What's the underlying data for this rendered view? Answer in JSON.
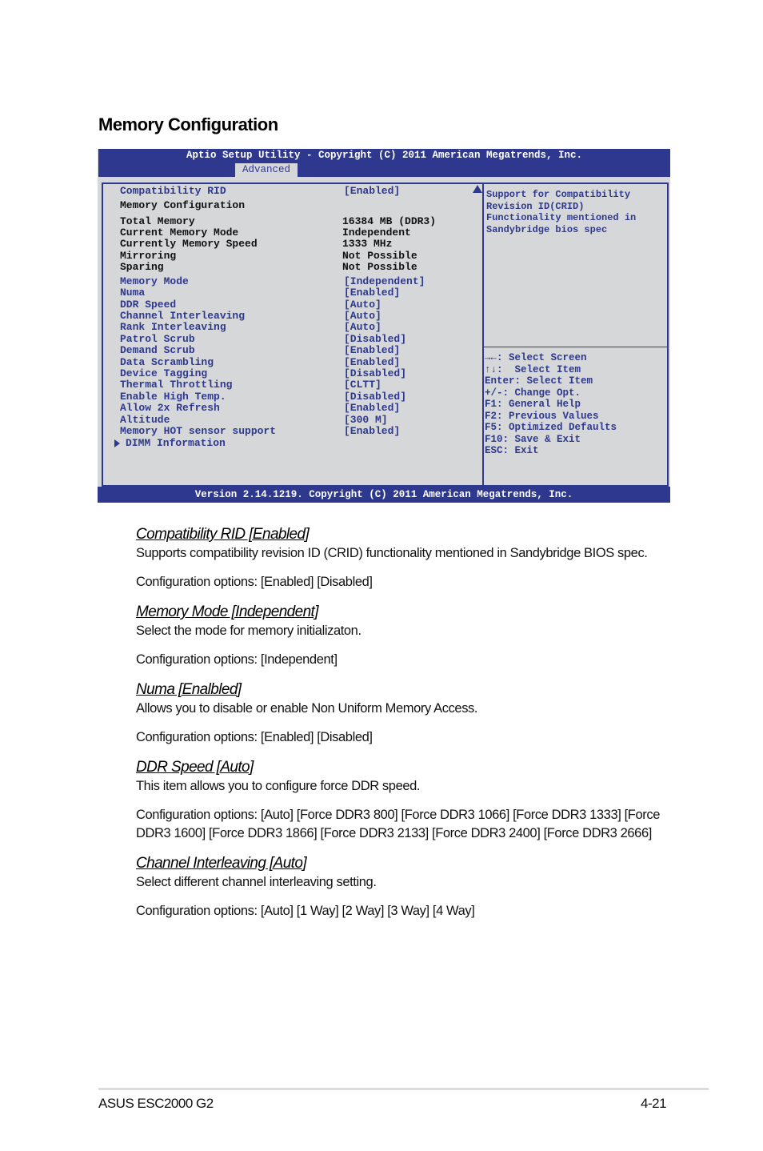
{
  "page": {
    "title": "Memory Configuration",
    "footer_left": "ASUS ESC2000 G2",
    "footer_right": "4-21"
  },
  "bios": {
    "header_title": "Aptio Setup Utility - Copyright (C) 2011 American Megatrends, Inc.",
    "active_tab": "Advanced",
    "footer": "Version 2.14.1219. Copyright (C) 2011 American Megatrends, Inc.",
    "colors": {
      "frame": "#2e388f",
      "background": "#d6d7d9",
      "text_static": "#111111"
    },
    "items": [
      {
        "label": "Compatibility RID",
        "value": "[Enabled]",
        "type": "option"
      },
      {
        "label": "Memory Configuration",
        "value": "",
        "type": "heading"
      },
      {
        "label": "Total Memory",
        "value": "16384 MB (DDR3)",
        "type": "info"
      },
      {
        "label": "Current Memory Mode",
        "value": "Independent",
        "type": "info"
      },
      {
        "label": "Currently Memory Speed",
        "value": "1333 MHz",
        "type": "info"
      },
      {
        "label": "Mirroring",
        "value": "Not Possible",
        "type": "info"
      },
      {
        "label": "Sparing",
        "value": "Not Possible",
        "type": "info"
      },
      {
        "label": "Memory Mode",
        "value": "[Independent]",
        "type": "option"
      },
      {
        "label": "Numa",
        "value": "[Enabled]",
        "type": "option"
      },
      {
        "label": "DDR Speed",
        "value": "[Auto]",
        "type": "option"
      },
      {
        "label": "Channel Interleaving",
        "value": "[Auto]",
        "type": "option"
      },
      {
        "label": "Rank Interleaving",
        "value": "[Auto]",
        "type": "option"
      },
      {
        "label": "Patrol Scrub",
        "value": "[Disabled]",
        "type": "option"
      },
      {
        "label": "Demand Scrub",
        "value": "[Enabled]",
        "type": "option"
      },
      {
        "label": "Data Scrambling",
        "value": "[Enabled]",
        "type": "option"
      },
      {
        "label": "Device Tagging",
        "value": "[Disabled]",
        "type": "option"
      },
      {
        "label": "Thermal Throttling",
        "value": "[CLTT]",
        "type": "option"
      },
      {
        "label": "Enable High Temp.",
        "value": "[Disabled]",
        "type": "option"
      },
      {
        "label": "Allow 2x Refresh",
        "value": "[Enabled]",
        "type": "option"
      },
      {
        "label": "Altitude",
        "value": "[300 M]",
        "type": "option"
      },
      {
        "label": "Memory HOT sensor support",
        "value": "[Enabled]",
        "type": "option"
      },
      {
        "label": "DIMM Information",
        "value": "",
        "type": "submenu"
      }
    ],
    "help_text": "Support for Compatibility\nRevision ID(CRID)\nFunctionality mentioned in\nSandybridge bios spec",
    "keys": [
      "→←: Select Screen",
      "↑↓:  Select Item",
      "Enter: Select Item",
      "+/-: Change Opt.",
      "F1: General Help",
      "F2: Previous Values",
      "F5: Optimized Defaults",
      "F10: Save & Exit",
      "ESC: Exit"
    ]
  },
  "sections": [
    {
      "title": "Compatibility RID [Enabled]",
      "description": "Supports compatibility revision ID (CRID) functionality mentioned in Sandybridge BIOS spec.",
      "options": "Configuration options: [Enabled] [Disabled]"
    },
    {
      "title": "Memory Mode [Independent]",
      "description": "Select the mode for memory initializaton.",
      "options": "Configuration options: [Independent]"
    },
    {
      "title": "Numa [Enalbled]",
      "description": "Allows you to disable or enable Non Uniform Memory Access.",
      "options": "Configuration options: [Enabled] [Disabled]"
    },
    {
      "title": "DDR Speed [Auto]",
      "description": "This item allows you to configure force DDR speed.",
      "options": "Configuration options: [Auto] [Force DDR3 800] [Force DDR3 1066] [Force DDR3 1333] [Force DDR3 1600] [Force DDR3 1866] [Force DDR3 2133] [Force DDR3 2400] [Force DDR3 2666]"
    },
    {
      "title": "Channel Interleaving [Auto]",
      "description": "Select different channel interleaving setting.",
      "options": "Configuration options: [Auto] [1 Way] [2 Way] [3 Way] [4 Way]"
    }
  ]
}
